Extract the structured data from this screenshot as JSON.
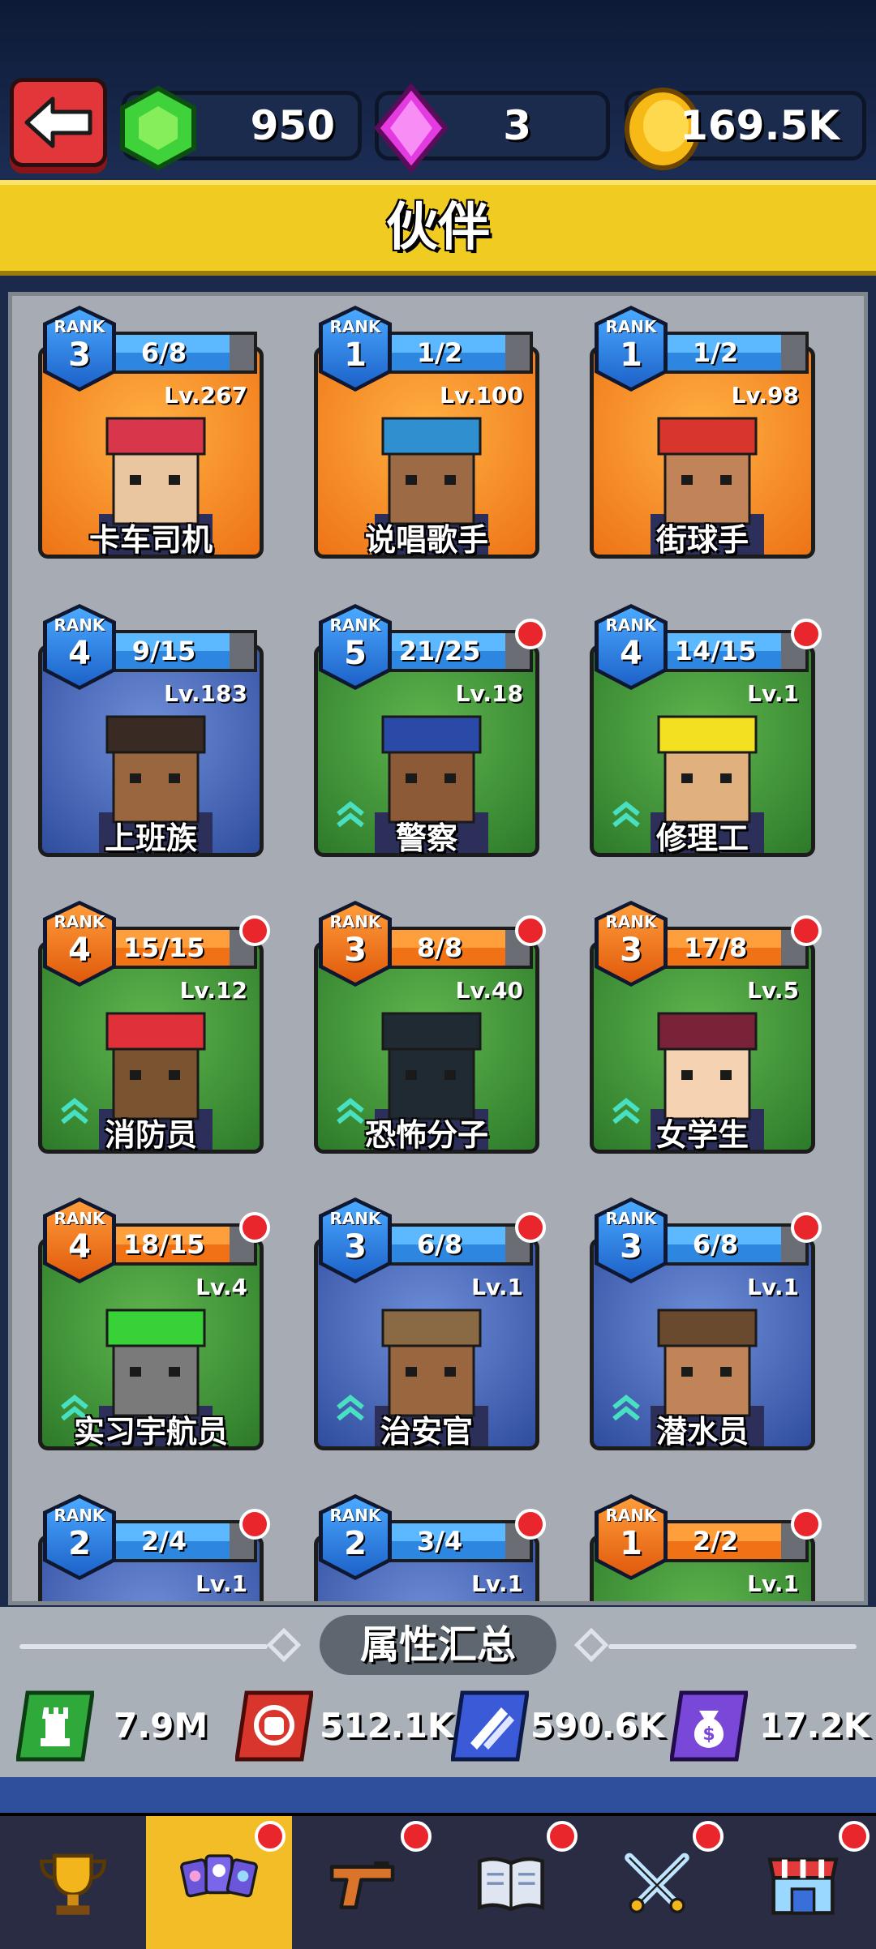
{
  "header": {
    "back_icon": "arrow-left-icon",
    "resources": [
      {
        "name": "green-gem",
        "icon": "green-gem-icon",
        "value": "950"
      },
      {
        "name": "pink-gem",
        "icon": "pink-gem-icon",
        "value": "3"
      },
      {
        "name": "coin",
        "icon": "gold-coin-icon",
        "value": "169.5K"
      }
    ]
  },
  "title": "伙伴",
  "partners": [
    {
      "name": "卡车司机",
      "rank_label": "RANK",
      "rank": "3",
      "progress": "6/8",
      "level": "Lv.267",
      "bg": "orange",
      "bar": "blue",
      "rank_color": "blue",
      "dot": false,
      "upgrade": false,
      "hat": "#d8364a",
      "skin": "#e9c5a0"
    },
    {
      "name": "说唱歌手",
      "rank_label": "RANK",
      "rank": "1",
      "progress": "1/2",
      "level": "Lv.100",
      "bg": "orange",
      "bar": "blue",
      "rank_color": "blue",
      "dot": false,
      "upgrade": false,
      "hat": "#2f8fcf",
      "skin": "#9c6a44"
    },
    {
      "name": "街球手",
      "rank_label": "RANK",
      "rank": "1",
      "progress": "1/2",
      "level": "Lv.98",
      "bg": "orange",
      "bar": "blue",
      "rank_color": "blue",
      "dot": false,
      "upgrade": false,
      "hat": "#d8362c",
      "skin": "#c08458"
    },
    {
      "name": "上班族",
      "rank_label": "RANK",
      "rank": "4",
      "progress": "9/15",
      "level": "Lv.183",
      "bg": "blue",
      "bar": "blue",
      "rank_color": "blue",
      "dot": false,
      "upgrade": false,
      "hat": "#3a2a24",
      "skin": "#9a6640"
    },
    {
      "name": "警察",
      "rank_label": "RANK",
      "rank": "5",
      "progress": "21/25",
      "level": "Lv.18",
      "bg": "green",
      "bar": "blue",
      "rank_color": "blue",
      "dot": true,
      "upgrade": true,
      "hat": "#2b4aa8",
      "skin": "#8c5a36"
    },
    {
      "name": "修理工",
      "rank_label": "RANK",
      "rank": "4",
      "progress": "14/15",
      "level": "Lv.1",
      "bg": "green",
      "bar": "blue",
      "rank_color": "blue",
      "dot": true,
      "upgrade": true,
      "hat": "#f3e021",
      "skin": "#e0b07e"
    },
    {
      "name": "消防员",
      "rank_label": "RANK",
      "rank": "4",
      "progress": "15/15",
      "level": "Lv.12",
      "bg": "green",
      "bar": "orange",
      "rank_color": "orange",
      "dot": true,
      "upgrade": true,
      "hat": "#e0303a",
      "skin": "#7a5430"
    },
    {
      "name": "恐怖分子",
      "rank_label": "RANK",
      "rank": "3",
      "progress": "8/8",
      "level": "Lv.40",
      "bg": "green",
      "bar": "orange",
      "rank_color": "orange",
      "dot": true,
      "upgrade": true,
      "hat": "#1f2a33",
      "skin": "#1f2a33"
    },
    {
      "name": "女学生",
      "rank_label": "RANK",
      "rank": "3",
      "progress": "17/8",
      "level": "Lv.5",
      "bg": "green",
      "bar": "orange",
      "rank_color": "orange",
      "dot": true,
      "upgrade": true,
      "hat": "#7a2238",
      "skin": "#f4d2b2"
    },
    {
      "name": "实习宇航员",
      "rank_label": "RANK",
      "rank": "4",
      "progress": "18/15",
      "level": "Lv.4",
      "bg": "green",
      "bar": "orange",
      "rank_color": "orange",
      "dot": true,
      "upgrade": true,
      "hat": "#38d238",
      "skin": "#7a7a7a"
    },
    {
      "name": "治安官",
      "rank_label": "RANK",
      "rank": "3",
      "progress": "6/8",
      "level": "Lv.1",
      "bg": "blue",
      "bar": "blue",
      "rank_color": "blue",
      "dot": true,
      "upgrade": true,
      "hat": "#8a6a44",
      "skin": "#9a6640"
    },
    {
      "name": "潜水员",
      "rank_label": "RANK",
      "rank": "3",
      "progress": "6/8",
      "level": "Lv.1",
      "bg": "blue",
      "bar": "blue",
      "rank_color": "blue",
      "dot": true,
      "upgrade": true,
      "hat": "#6a4a2e",
      "skin": "#c08458"
    },
    {
      "name": "",
      "rank_label": "RANK",
      "rank": "2",
      "progress": "2/4",
      "level": "Lv.1",
      "bg": "blue",
      "bar": "blue",
      "rank_color": "blue",
      "dot": true,
      "upgrade": false,
      "hat": "#444",
      "skin": "#aaa"
    },
    {
      "name": "",
      "rank_label": "RANK",
      "rank": "2",
      "progress": "3/4",
      "level": "Lv.1",
      "bg": "blue",
      "bar": "blue",
      "rank_color": "blue",
      "dot": true,
      "upgrade": false,
      "hat": "#444",
      "skin": "#aaa"
    },
    {
      "name": "",
      "rank_label": "RANK",
      "rank": "1",
      "progress": "2/2",
      "level": "Lv.1",
      "bg": "green",
      "bar": "orange",
      "rank_color": "orange",
      "dot": true,
      "upgrade": false,
      "hat": "#444",
      "skin": "#aaa"
    }
  ],
  "summary": {
    "title": "属性汇总",
    "stats": [
      {
        "icon": "tower-icon",
        "value": "7.9M",
        "color": "#2ea93a"
      },
      {
        "icon": "fist-icon",
        "value": "512.1K",
        "color": "#d8362c"
      },
      {
        "icon": "auto-bullets-icon",
        "value": "590.6K",
        "color": "#3a5ad8"
      },
      {
        "icon": "money-bag-icon",
        "value": "17.2K",
        "color": "#7a48d8"
      }
    ]
  },
  "nav": [
    {
      "name": "trophy",
      "icon": "trophy-icon",
      "dot": false,
      "active": false
    },
    {
      "name": "partners",
      "icon": "partner-cards-icon",
      "dot": true,
      "active": true
    },
    {
      "name": "weapons",
      "icon": "pistol-icon",
      "dot": true,
      "active": false
    },
    {
      "name": "book",
      "icon": "book-icon",
      "dot": true,
      "active": false
    },
    {
      "name": "battle",
      "icon": "crossed-swords-icon",
      "dot": true,
      "active": false
    },
    {
      "name": "shop",
      "icon": "shop-icon",
      "dot": true,
      "active": false
    }
  ]
}
